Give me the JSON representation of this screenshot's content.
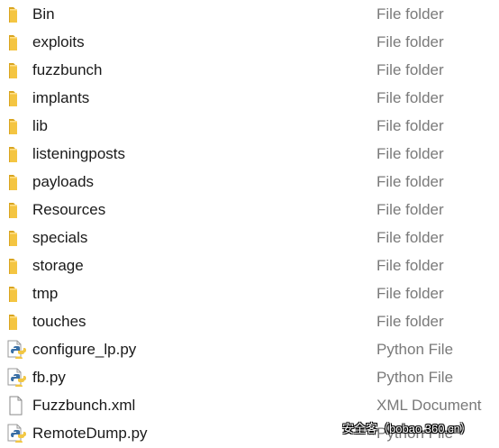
{
  "files": [
    {
      "name": "Bin",
      "type": "File folder",
      "icon": "folder-icon"
    },
    {
      "name": "exploits",
      "type": "File folder",
      "icon": "folder-icon"
    },
    {
      "name": "fuzzbunch",
      "type": "File folder",
      "icon": "folder-icon"
    },
    {
      "name": "implants",
      "type": "File folder",
      "icon": "folder-icon"
    },
    {
      "name": "lib",
      "type": "File folder",
      "icon": "folder-icon"
    },
    {
      "name": "listeningposts",
      "type": "File folder",
      "icon": "folder-icon"
    },
    {
      "name": "payloads",
      "type": "File folder",
      "icon": "folder-icon"
    },
    {
      "name": "Resources",
      "type": "File folder",
      "icon": "folder-icon"
    },
    {
      "name": "specials",
      "type": "File folder",
      "icon": "folder-icon"
    },
    {
      "name": "storage",
      "type": "File folder",
      "icon": "folder-icon"
    },
    {
      "name": "tmp",
      "type": "File folder",
      "icon": "folder-icon"
    },
    {
      "name": "touches",
      "type": "File folder",
      "icon": "folder-icon"
    },
    {
      "name": "configure_lp.py",
      "type": "Python File",
      "icon": "python-file-icon"
    },
    {
      "name": "fb.py",
      "type": "Python File",
      "icon": "python-file-icon"
    },
    {
      "name": "Fuzzbunch.xml",
      "type": "XML Document",
      "icon": "xml-document-icon"
    },
    {
      "name": "RemoteDump.py",
      "type": "Python File",
      "icon": "python-file-icon"
    }
  ],
  "watermark": "安全客（bobao.360.cn）",
  "colors": {
    "folder": "#f4c542",
    "python_blue": "#3a6fa5",
    "python_yellow": "#f2c744",
    "name_text": "#1a1a1a",
    "type_text": "#7a7a7a"
  }
}
